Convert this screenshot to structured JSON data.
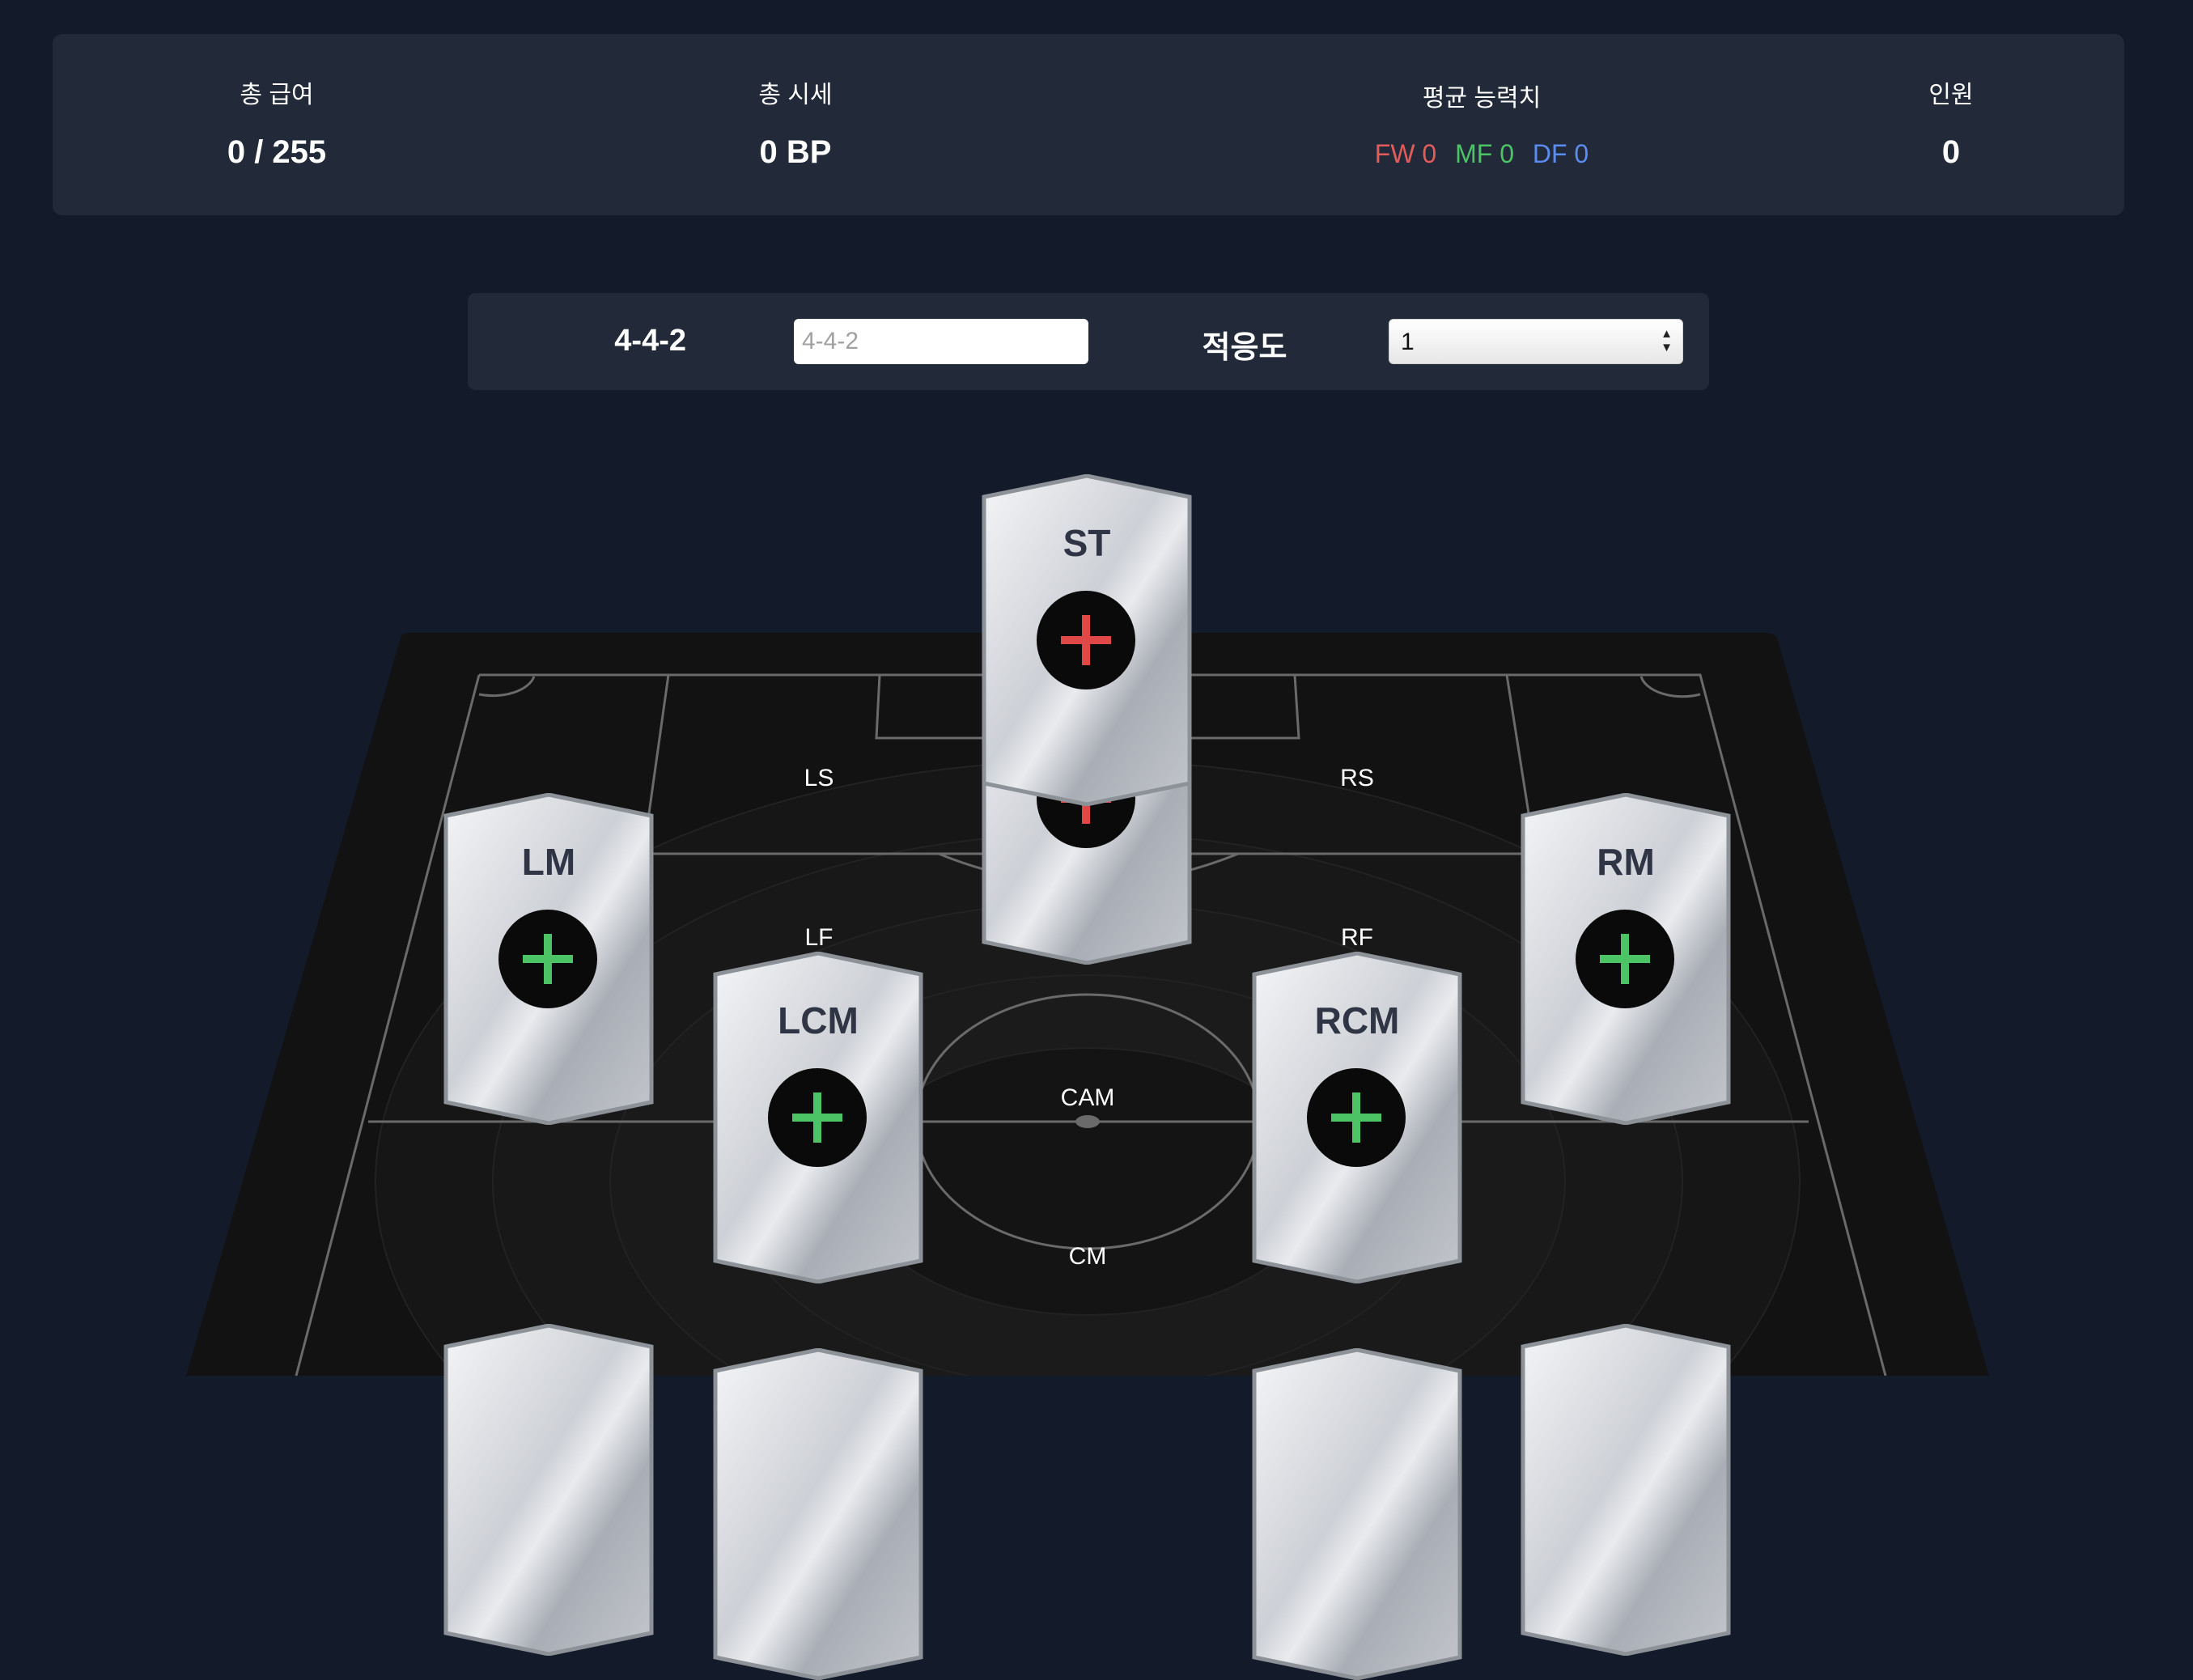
{
  "stats": {
    "salary_label": "총 급여",
    "salary_value": "0 / 255",
    "market_label": "총 시세",
    "market_value": "0 BP",
    "ability_label": "평균 능력치",
    "ability": {
      "fw": "FW 0",
      "mf": "MF 0",
      "df": "DF 0"
    },
    "headcount_label": "인원",
    "headcount_value": "0"
  },
  "formation": {
    "label": "4-4-2",
    "input_value": "",
    "input_placeholder": "4-4-2",
    "adapt_label": "적응도",
    "adapt_value": "1"
  },
  "pitch_labels": {
    "ls": "LS",
    "rs": "RS",
    "lf": "LF",
    "rf": "RF",
    "cam": "CAM",
    "cm": "CM"
  },
  "cards": {
    "st": "ST",
    "lm": "LM",
    "rm": "RM",
    "lcm": "LCM",
    "rcm": "RCM"
  },
  "colors": {
    "background": "#131a2a",
    "panel": "#222a39",
    "fw": "#e25c5c",
    "mf": "#4cc466",
    "df": "#5b8cf0",
    "add_forward": "#e04848",
    "add_midfield": "#4cc466"
  },
  "icons": {
    "add": "plus-icon",
    "select_arrows": "select-arrows-icon"
  }
}
